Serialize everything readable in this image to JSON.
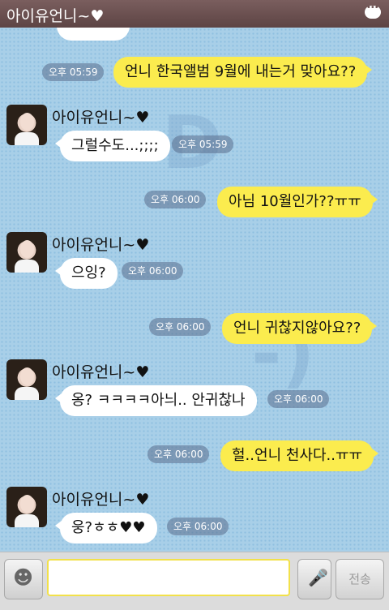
{
  "header": {
    "title": "아이유언니~♥",
    "menu_icon": "more-icon"
  },
  "messages": [
    {
      "type": "sent",
      "text": "언니 한국앨범 9월에 내는거 맞아요??",
      "time": "오후 05:59"
    },
    {
      "type": "received",
      "sender": "아이유언니~♥",
      "text": "그럴수도...;;;;",
      "time": "오후 05:59"
    },
    {
      "type": "sent",
      "text": "아님 10월인가??ㅠㅠ",
      "time": "오후 06:00"
    },
    {
      "type": "received",
      "sender": "아이유언니~♥",
      "text": "으잉?",
      "time": "오후 06:00"
    },
    {
      "type": "sent",
      "text": "언니 귀찮지않아요??",
      "time": "오후 06:00"
    },
    {
      "type": "received",
      "sender": "아이유언니~♥",
      "text": "옹? ㅋㅋㅋㅋ아늬.. 안귀찮나",
      "time": "오후 06:00"
    },
    {
      "type": "sent",
      "text": "헐..언니 천사다..ㅠㅠ",
      "time": "오후 06:00"
    },
    {
      "type": "received",
      "sender": "아이유언니~♥",
      "text": "웅?ㅎㅎ♥♥",
      "time": "오후 06:00"
    }
  ],
  "input_bar": {
    "send_label": "전송",
    "emoji_icon": "emoticon-icon",
    "mic_icon": "microphone-icon",
    "placeholder": ""
  }
}
